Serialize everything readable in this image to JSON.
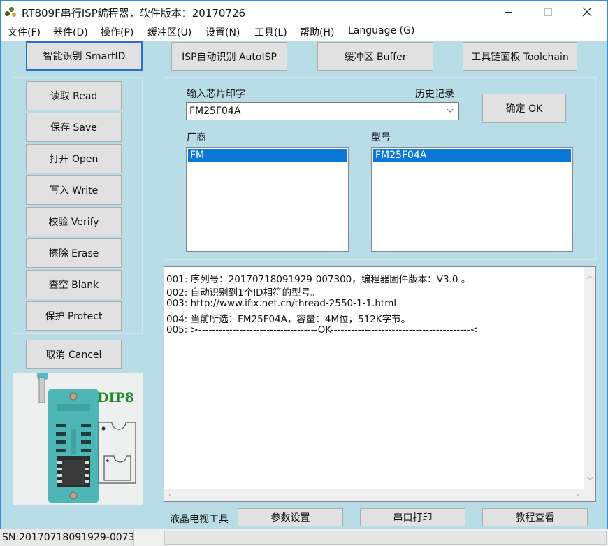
{
  "window": {
    "title": "RT809F串行ISP编程器，软件版本：20170726",
    "icon": "app-logo-icon",
    "controls": {
      "minimize": "minimize-icon",
      "maximize": "maximize-icon",
      "close": "close-icon"
    }
  },
  "menu": {
    "items": [
      {
        "label": "文件(F)"
      },
      {
        "label": "器件(D)"
      },
      {
        "label": "操作(P)"
      },
      {
        "label": "缓冲区(U)"
      },
      {
        "label": "设置(N)"
      },
      {
        "label": "工具(L)"
      },
      {
        "label": "帮助(H)"
      },
      {
        "label": "Language (G)"
      }
    ]
  },
  "top_buttons": [
    {
      "label": "智能识别 SmartID"
    },
    {
      "label": "ISP自动识别 AutoISP"
    },
    {
      "label": "缓冲区 Buffer"
    },
    {
      "label": "工具链面板 Toolchain"
    }
  ],
  "operation_buttons": [
    {
      "label": "读取 Read"
    },
    {
      "label": "保存 Save"
    },
    {
      "label": "打开 Open"
    },
    {
      "label": "写入 Write"
    },
    {
      "label": "校验 Verify"
    },
    {
      "label": "擦除 Erase"
    },
    {
      "label": "查空 Blank"
    },
    {
      "label": "保护 Protect"
    }
  ],
  "cancel_button": {
    "label": "取消 Cancel"
  },
  "chip_search": {
    "input_label": "输入芯片印字",
    "history_label": "历史记录",
    "value": "FM25F04A",
    "ok_label": "确定 OK"
  },
  "manufacturer": {
    "label": "厂商",
    "items": [
      "FM"
    ],
    "selected": "FM"
  },
  "model": {
    "label": "型号",
    "items": [
      "FM25F04A"
    ],
    "selected": "FM25F04A"
  },
  "log": {
    "lines": [
      "001: 序列号：20170718091929-007300，编程器固件版本：V3.0 。",
      "002: 自动识别到1个ID相符的型号。",
      "003: http://www.ifix.net.cn/thread-2550-1-1.html",
      "004: 当前所选：FM25F04A，容量：4M位，512K字节。",
      "005: >-----------------------------------OK-----------------------------------------<"
    ]
  },
  "package_image": {
    "label": "DIP8"
  },
  "lcd_tools": {
    "label": "液晶电视工具",
    "buttons": [
      {
        "label": "参数设置"
      },
      {
        "label": "串口打印"
      },
      {
        "label": "教程查看"
      }
    ]
  },
  "statusbar": {
    "sn": "SN:20170718091929-0073"
  },
  "colors": {
    "background": "#b9dde7",
    "window_border": "#3c8dd8",
    "selection": "#0a78d7",
    "button_face": "#e1e1e1",
    "dip_label": "#1e8a2a"
  }
}
